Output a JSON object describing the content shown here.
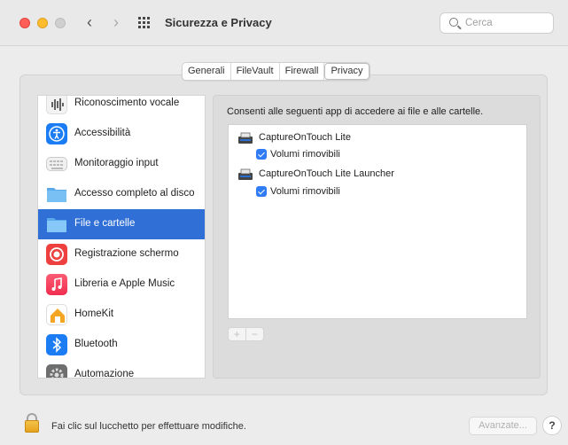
{
  "window": {
    "title": "Sicurezza e Privacy",
    "search_placeholder": "Cerca"
  },
  "tabs": [
    {
      "label": "Generali",
      "active": false
    },
    {
      "label": "FileVault",
      "active": false
    },
    {
      "label": "Firewall",
      "active": false
    },
    {
      "label": "Privacy",
      "active": true
    }
  ],
  "sidebar": {
    "items": [
      {
        "label": "Riconoscimento vocale",
        "icon": "waveform-icon"
      },
      {
        "label": "Accessibilità",
        "icon": "accessibility-icon"
      },
      {
        "label": "Monitoraggio input",
        "icon": "keyboard-icon"
      },
      {
        "label": "Accesso completo al disco",
        "icon": "folder-icon"
      },
      {
        "label": "File e cartelle",
        "icon": "folder-icon",
        "selected": true
      },
      {
        "label": "Registrazione schermo",
        "icon": "screen-record-icon"
      },
      {
        "label": "Libreria e Apple Music",
        "icon": "music-icon"
      },
      {
        "label": "HomeKit",
        "icon": "home-icon"
      },
      {
        "label": "Bluetooth",
        "icon": "bluetooth-icon"
      },
      {
        "label": "Automazione",
        "icon": "gear-icon"
      }
    ]
  },
  "main": {
    "description": "Consenti alle seguenti app di accedere ai file e alle cartelle.",
    "apps": [
      {
        "name": "CaptureOnTouch Lite",
        "permission": "Volumi rimovibili",
        "checked": true
      },
      {
        "name": "CaptureOnTouch Lite Launcher",
        "permission": "Volumi rimovibili",
        "checked": true
      }
    ],
    "add_label": "+",
    "remove_label": "−"
  },
  "footer": {
    "lock_text": "Fai clic sul lucchetto per effettuare modifiche.",
    "advanced_label": "Avanzate...",
    "help_label": "?"
  },
  "colors": {
    "accent": "#2f6fd6",
    "checkbox": "#2f7cf6"
  }
}
